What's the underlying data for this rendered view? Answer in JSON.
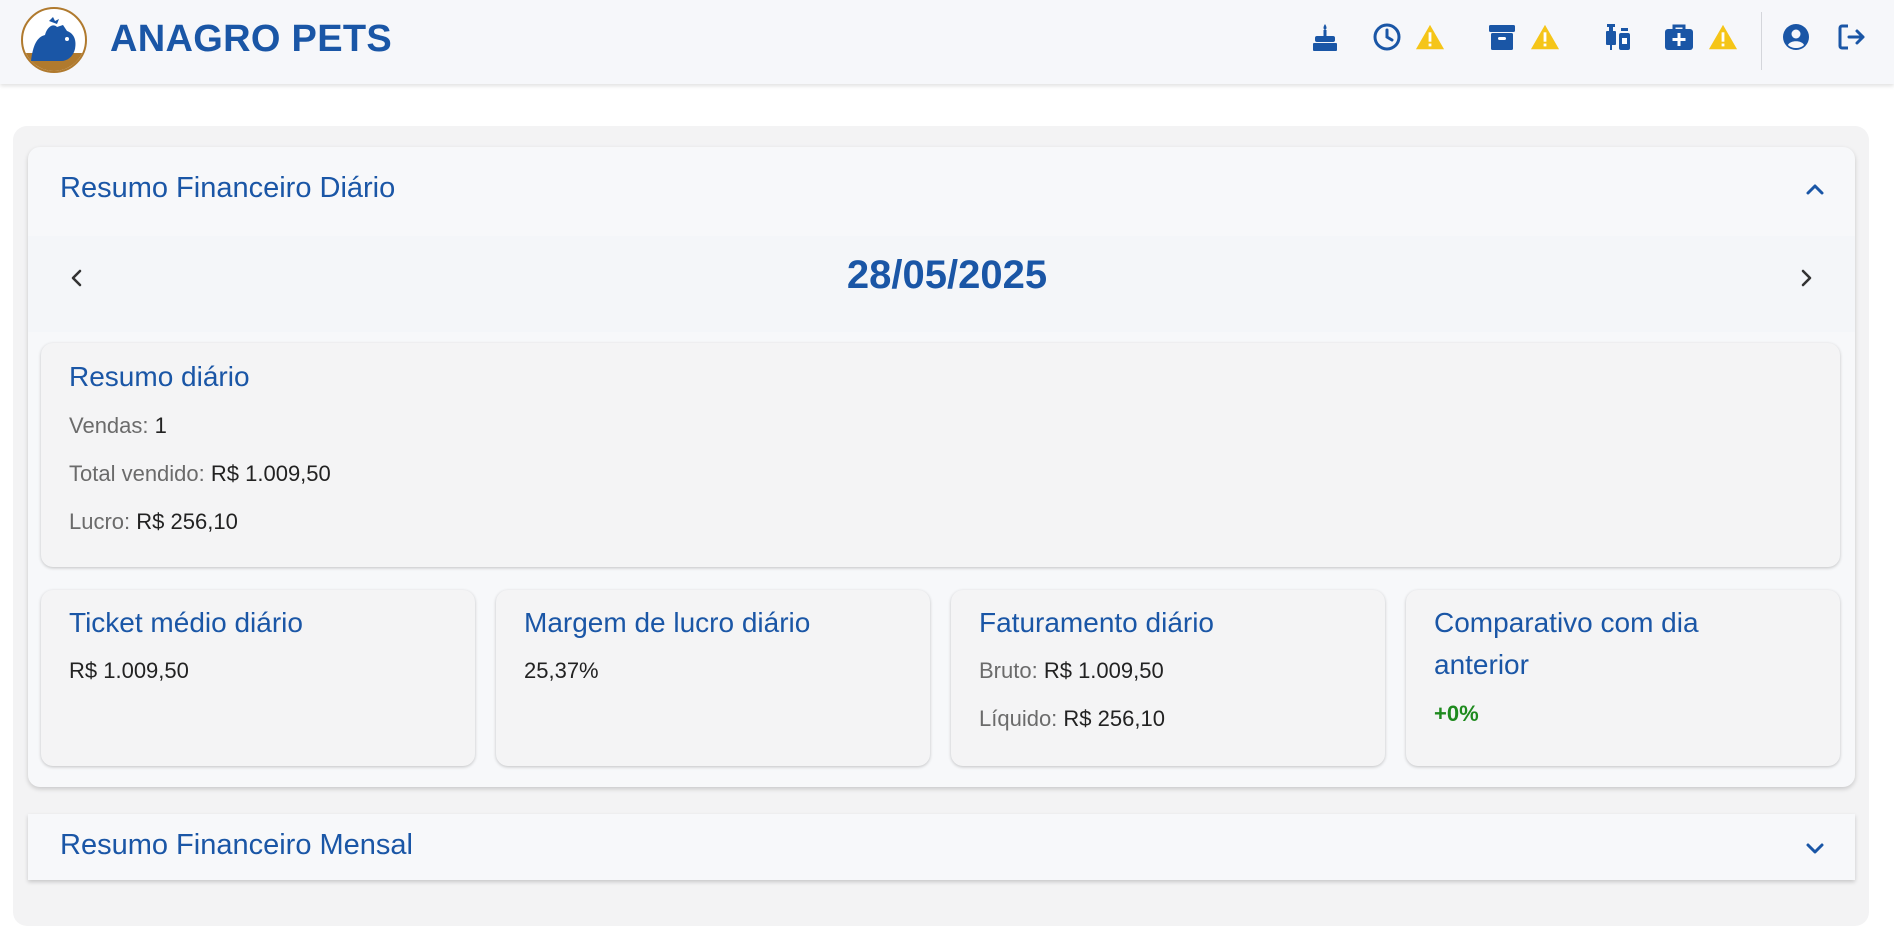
{
  "header": {
    "brand": "ANAGRO PETS",
    "icons": [
      "cake-icon",
      "clock-icon",
      "warning-icon",
      "archive-icon",
      "warning-icon",
      "vaccine-icon",
      "medical-kit-icon",
      "warning-icon",
      "user-icon",
      "logout-icon"
    ]
  },
  "colors": {
    "primary": "#1a56a6",
    "warning": "#f5c518",
    "positive": "#1e8a1e"
  },
  "daily": {
    "title": "Resumo Financeiro Diário",
    "date": "28/05/2025",
    "summary": {
      "title": "Resumo diário",
      "sales_label": "Vendas:",
      "sales_value": "1",
      "total_label": "Total vendido:",
      "total_value": "R$ 1.009,50",
      "profit_label": "Lucro:",
      "profit_value": "R$ 256,10"
    },
    "ticket": {
      "title": "Ticket médio diário",
      "value": "R$ 1.009,50"
    },
    "margin": {
      "title": "Margem de lucro diário",
      "value": "25,37%"
    },
    "revenue": {
      "title": "Faturamento diário",
      "gross_label": "Bruto:",
      "gross_value": "R$ 1.009,50",
      "net_label": "Líquido:",
      "net_value": "R$ 256,10"
    },
    "comparison": {
      "title_line1": "Comparativo com dia",
      "title_line2": "anterior",
      "value": "+0%"
    }
  },
  "monthly": {
    "title": "Resumo Financeiro Mensal"
  }
}
